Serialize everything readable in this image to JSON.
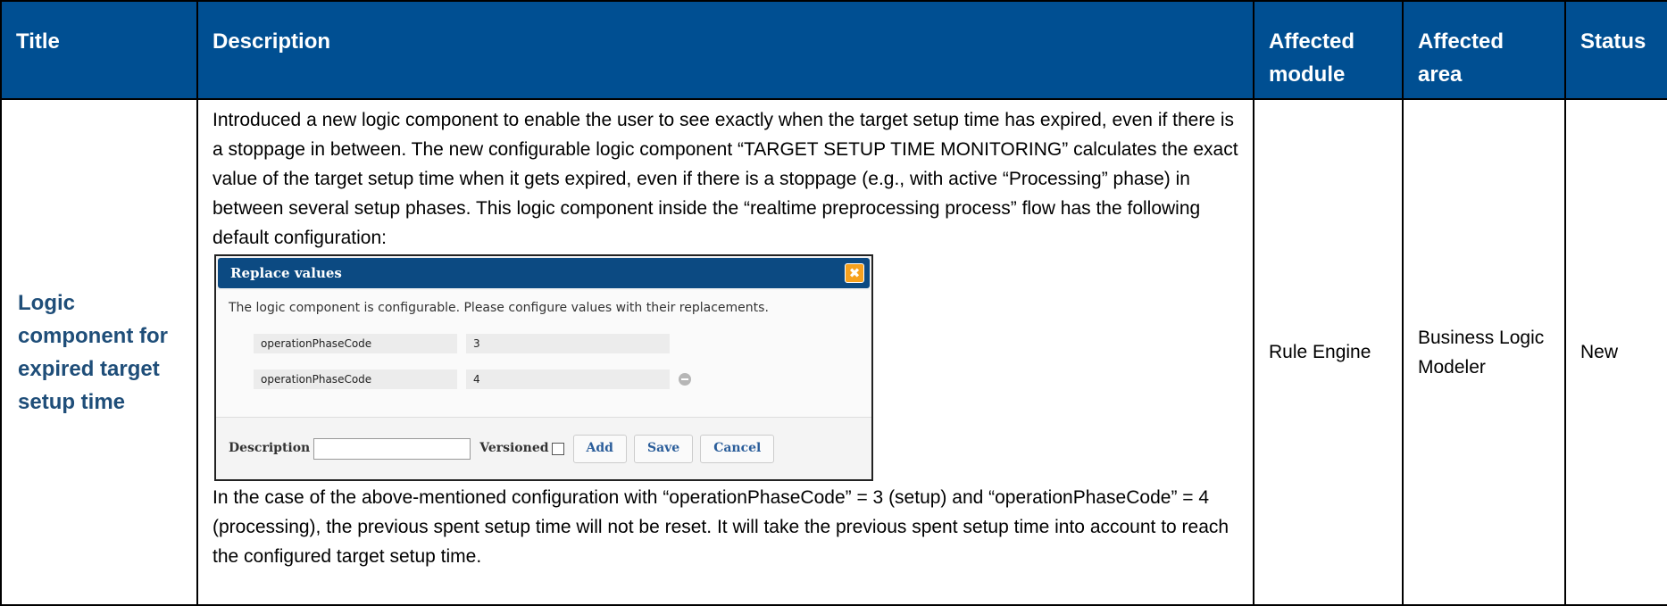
{
  "headers": {
    "title": "Title",
    "description": "Description",
    "module": "Affected module",
    "area": "Affected area",
    "status": "Status"
  },
  "row": {
    "title": "Logic component for expired target setup time",
    "description_intro": "Introduced a new logic component to enable the user to see exactly when the target setup time has expired, even if there is a stoppage in between. The new configurable logic component “TARGET SETUP TIME MONITORING” calculates the exact value of the target setup time when it gets expired, even if there is a stoppage (e.g., with active “Processing” phase) in between several setup phases. This logic component inside the “realtime preprocessing process” flow has the following default configuration:",
    "description_outro": "In the case of the above-mentioned configuration with “operationPhaseCode” = 3 (setup) and “operationPhaseCode” = 4 (processing), the previous spent setup time will not be reset. It will take the previous spent setup time into account to reach the configured target setup time.",
    "module": "Rule Engine",
    "area": "Business Logic Modeler",
    "status": "New"
  },
  "dialog": {
    "title": "Replace values",
    "close_glyph": "✖",
    "hint": "The logic component is configurable. Please configure values with their replacements.",
    "rows": [
      {
        "key": "operationPhaseCode",
        "value": "3"
      },
      {
        "key": "operationPhaseCode",
        "value": "4"
      }
    ],
    "description_label": "Description",
    "versioned_label": "Versioned",
    "add_label": "Add",
    "save_label": "Save",
    "cancel_label": "Cancel"
  },
  "colors": {
    "header_bg": "#004f92",
    "dialog_header_bg": "#0c4a82",
    "title_text": "#1f4e79",
    "close_button": "#f6a11e"
  }
}
